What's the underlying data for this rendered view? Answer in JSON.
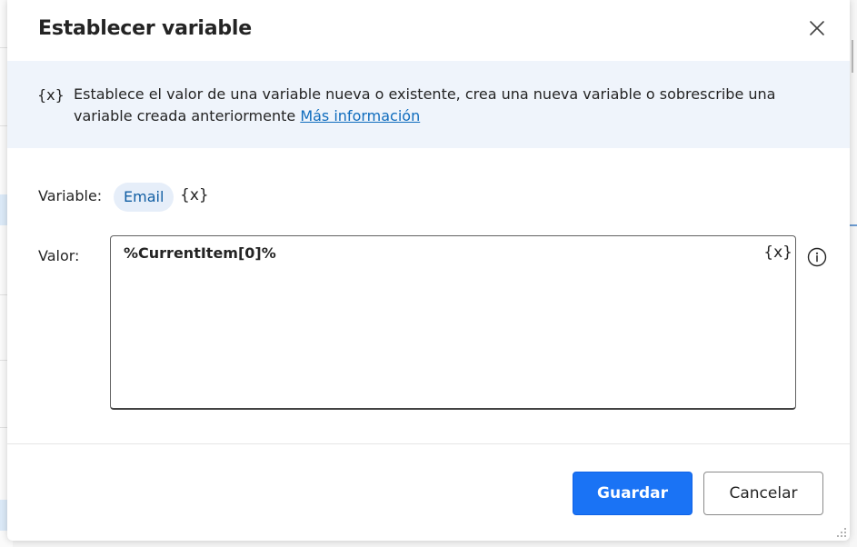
{
  "dialog": {
    "title": "Establecer variable",
    "close_icon": "close-icon"
  },
  "info": {
    "icon_text": "{x}",
    "description": "Establece el valor de una variable nueva o existente, crea una nueva variable o sobrescribe una variable creada anteriormente",
    "link_label": "Más información"
  },
  "form": {
    "variable_label": "Variable:",
    "variable_value": "Email",
    "variable_picker": "{x}",
    "valor_label": "Valor:",
    "valor_value": "%CurrentItem[0]%",
    "valor_picker": "{x}",
    "help_icon": "info-circle-icon"
  },
  "footer": {
    "save_label": "Guardar",
    "cancel_label": "Cancelar"
  },
  "colors": {
    "primary": "#1a73f5",
    "link": "#0f6cbd",
    "info_band": "#eff4fb",
    "chip_bg": "#e6eef9",
    "chip_text": "#115ea3"
  }
}
